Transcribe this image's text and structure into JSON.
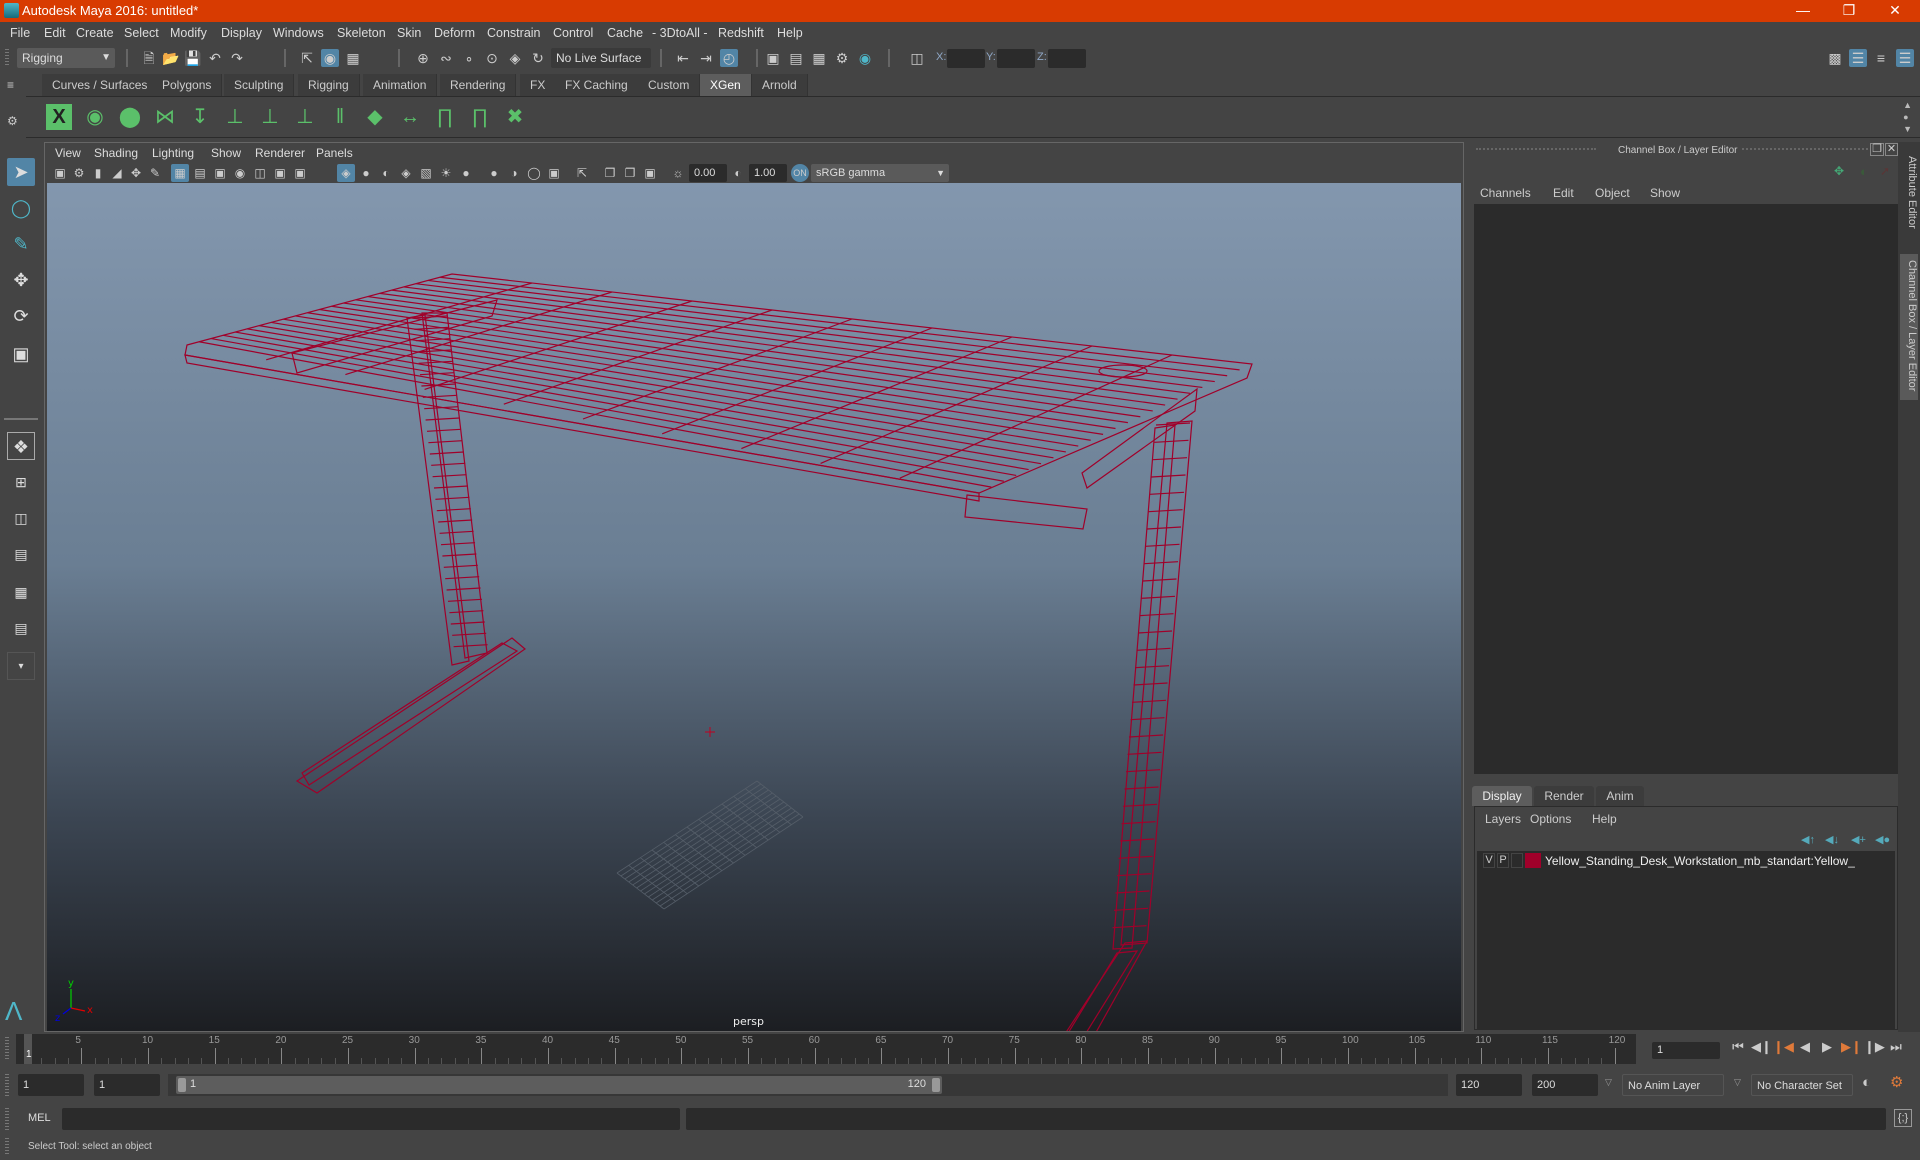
{
  "window": {
    "title": "Autodesk Maya 2016: untitled*",
    "controls": [
      "minimize",
      "restore",
      "close"
    ]
  },
  "menubar": [
    "File",
    "Edit",
    "Create",
    "Select",
    "Modify",
    "Display",
    "Windows",
    "Skeleton",
    "Skin",
    "Deform",
    "Constrain",
    "Control",
    "Cache",
    "- 3DtoAll -",
    "Redshift",
    "Help"
  ],
  "statusline": {
    "menuset": "Rigging",
    "live_surface": "No Live Surface",
    "xyz": {
      "x_label": "X:",
      "y_label": "Y:",
      "z_label": "Z:",
      "x": "",
      "y": "",
      "z": ""
    }
  },
  "shelf": {
    "tabs": [
      "Curves / Surfaces",
      "Polygons",
      "Sculpting",
      "Rigging",
      "Animation",
      "Rendering",
      "FX",
      "FX Caching",
      "Custom",
      "XGen",
      "Arnold"
    ],
    "active_tab": "XGen",
    "icons": [
      "xgen-window-icon",
      "preview-visible-icon",
      "preview-hidden-icon",
      "add-guide-icon",
      "place-guides-icon",
      "add-primitive-icon",
      "show-primitive-icon",
      "lock-guide-icon",
      "split-guide-icon",
      "patch-layers-icon",
      "interactive-groom-icon",
      "select-guides-icon",
      "region-map-icon",
      "delete-guide-icon"
    ]
  },
  "viewport": {
    "menu": [
      "View",
      "Shading",
      "Lighting",
      "Show",
      "Renderer",
      "Panels"
    ],
    "exposure": "0.00",
    "gamma": "1.00",
    "color_space": "sRGB gamma",
    "camera_label": "persp",
    "axis": {
      "x": "x",
      "y": "y",
      "z": "z"
    },
    "wire_color": "#a0002a"
  },
  "channelbox": {
    "title": "Channel Box / Layer Editor",
    "menu": [
      "Channels",
      "Edit",
      "Object",
      "Show"
    ],
    "layer_tabs": [
      "Display",
      "Render",
      "Anim"
    ],
    "active_layer_tab": "Display",
    "layer_menu": [
      "Layers",
      "Options",
      "Help"
    ],
    "layers": [
      {
        "v": "V",
        "p": "P",
        "color": "#a0002a",
        "name": "Yellow_Standing_Desk_Workstation_mb_standart:Yellow_"
      }
    ]
  },
  "side_tabs": [
    "Attribute Editor",
    "Channel Box / Layer Editor"
  ],
  "timeline": {
    "ticks": [
      "5",
      "10",
      "15",
      "20",
      "25",
      "30",
      "35",
      "40",
      "45",
      "50",
      "55",
      "60",
      "65",
      "70",
      "75",
      "80",
      "85",
      "90",
      "95",
      "100",
      "105",
      "110",
      "115",
      "120"
    ],
    "current_frame_marker": "1",
    "current_frame": "1"
  },
  "range": {
    "start": "1",
    "playback_start": "1",
    "slider_start": "1",
    "slider_end": "120",
    "playback_end": "120",
    "end": "200",
    "anim_layer": "No Anim Layer",
    "character_set": "No Character Set"
  },
  "mel": {
    "label": "MEL",
    "input": "",
    "output": ""
  },
  "helpline": "Select Tool: select an object"
}
